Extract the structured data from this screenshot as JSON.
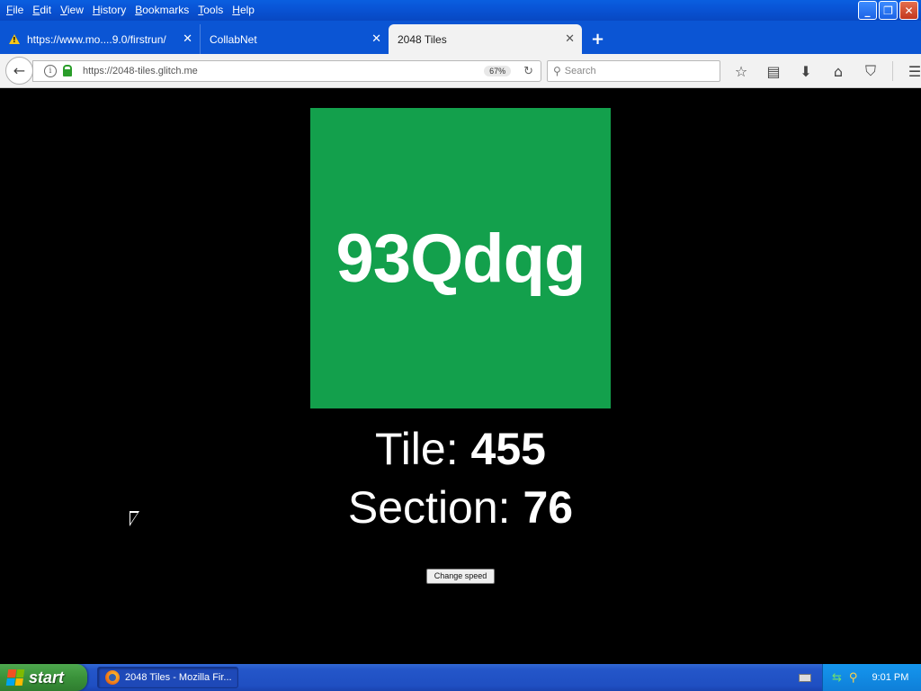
{
  "menubar": {
    "items": [
      {
        "label": "File",
        "key": "F",
        "rest": "ile"
      },
      {
        "label": "Edit",
        "key": "E",
        "rest": "dit"
      },
      {
        "label": "View",
        "key": "V",
        "rest": "iew"
      },
      {
        "label": "History",
        "key": "H",
        "rest": "istory"
      },
      {
        "label": "Bookmarks",
        "key": "B",
        "rest": "ookmarks"
      },
      {
        "label": "Tools",
        "key": "T",
        "rest": "ools"
      },
      {
        "label": "Help",
        "key": "H",
        "rest": "elp"
      }
    ]
  },
  "window_controls": {
    "minimize": "_",
    "restore": "❐",
    "close": "✕"
  },
  "tabs": [
    {
      "label": "https://www.mo....9.0/firstrun/",
      "close": "✕"
    },
    {
      "label": "CollabNet",
      "close": "✕"
    },
    {
      "label": "2048 Tiles",
      "close": "✕"
    }
  ],
  "new_tab": "+",
  "navbar": {
    "url": "https://2048-tiles.glitch.me",
    "zoom": "67%",
    "search_placeholder": "Search"
  },
  "page": {
    "tile_code": "93Qdqg",
    "tile_color": "#13a04c",
    "tile_label": "Tile:",
    "tile_value": "455",
    "section_label": "Section:",
    "section_value": "76",
    "button_label": "Change speed"
  },
  "taskbar": {
    "start_label": "start",
    "task_label": "2048 Tiles - Mozilla Fir...",
    "clock": "9:01 PM"
  }
}
